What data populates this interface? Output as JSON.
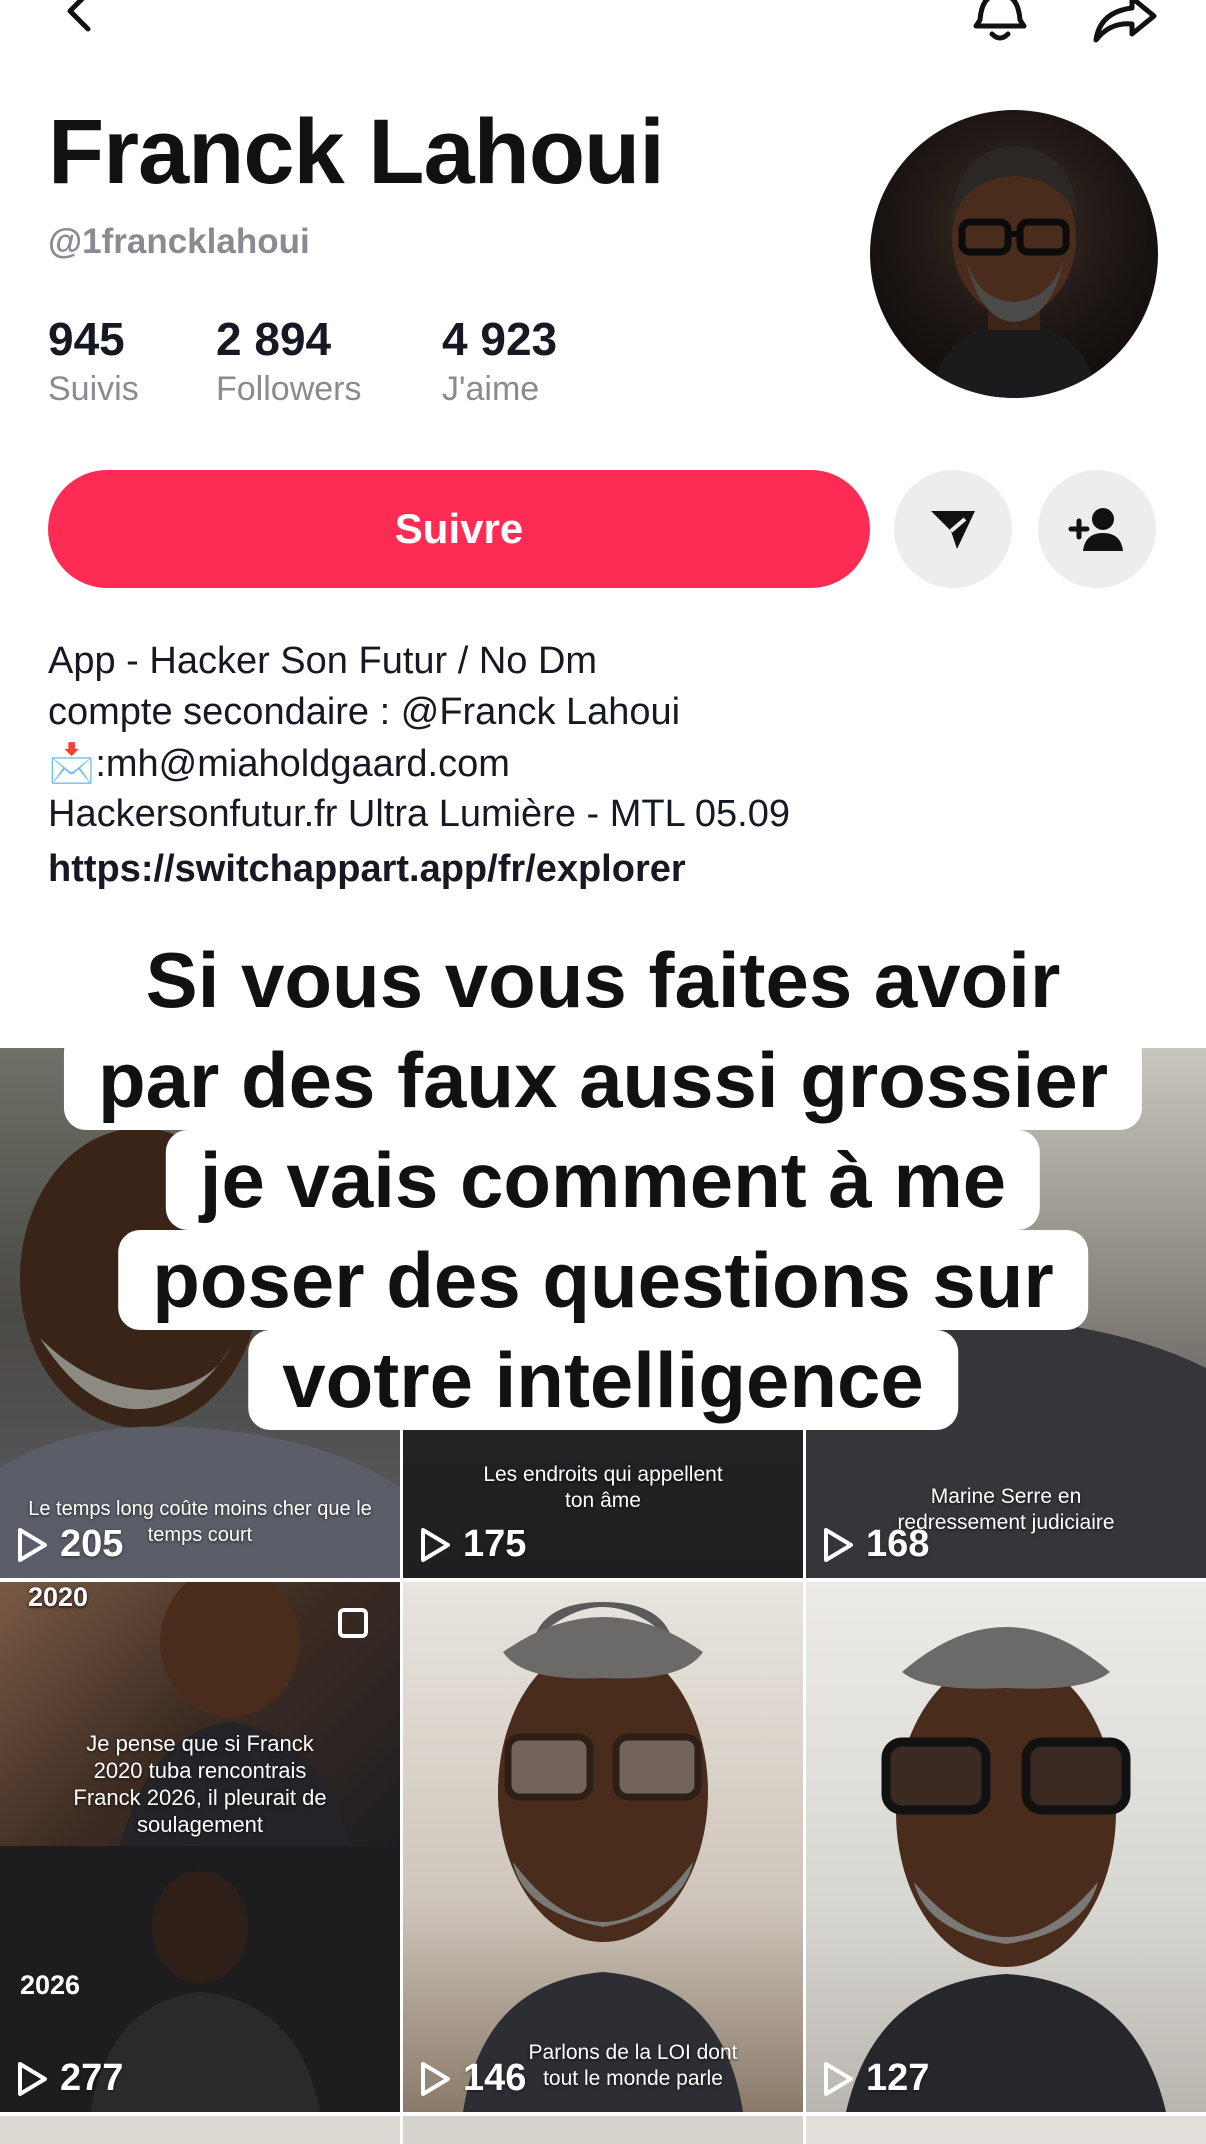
{
  "nav": {
    "back_icon": "chevron-left-icon",
    "bell_icon": "bell-icon",
    "share_icon": "share-arrow-icon"
  },
  "profile": {
    "name": "Franck Lahoui",
    "handle": "@1francklahoui",
    "stats": [
      {
        "value": "945",
        "label": "Suivis"
      },
      {
        "value": "2 894",
        "label": "Followers"
      },
      {
        "value": "4 923",
        "label": "J'aime"
      }
    ]
  },
  "actions": {
    "follow_label": "Suivre",
    "message_icon": "send-icon",
    "add_friend_icon": "add-user-icon"
  },
  "bio": {
    "lines": [
      "App - Hacker Son Futur / No Dm",
      "compte secondaire : @Franck Lahoui",
      ":mh@miaholdgaard.com",
      "Hackersonfutur.fr Ultra Lumière - MTL 05.09"
    ],
    "email_icon": "📩",
    "link": "https://switchappart.app/fr/explorer"
  },
  "overlay_lines": [
    "Si vous vous faites avoir",
    "par des faux aussi grossier",
    "je vais comment à me",
    "poser des questions sur",
    "votre intelligence"
  ],
  "videos": [
    {
      "count": "205",
      "caption": "Le temps long coûte moins cher que le temps court"
    },
    {
      "count": "175",
      "caption": "Les endroits qui appellent ton âme"
    },
    {
      "count": "168",
      "caption": "Marine Serre en redressement judiciaire"
    },
    {
      "count": "277",
      "caption": "Je pense que si Franck 2020 tuba rencontrais Franck 2026, il pleurait de soulagement",
      "label_top": "2020",
      "label_bottom": "2026"
    },
    {
      "count": "146",
      "caption": "Parlons de la LOI dont tout le monde parle"
    },
    {
      "count": "127",
      "caption": ""
    }
  ],
  "colors": {
    "accent": "#fe2c55",
    "muted": "#8a8b91",
    "text": "#161823"
  }
}
